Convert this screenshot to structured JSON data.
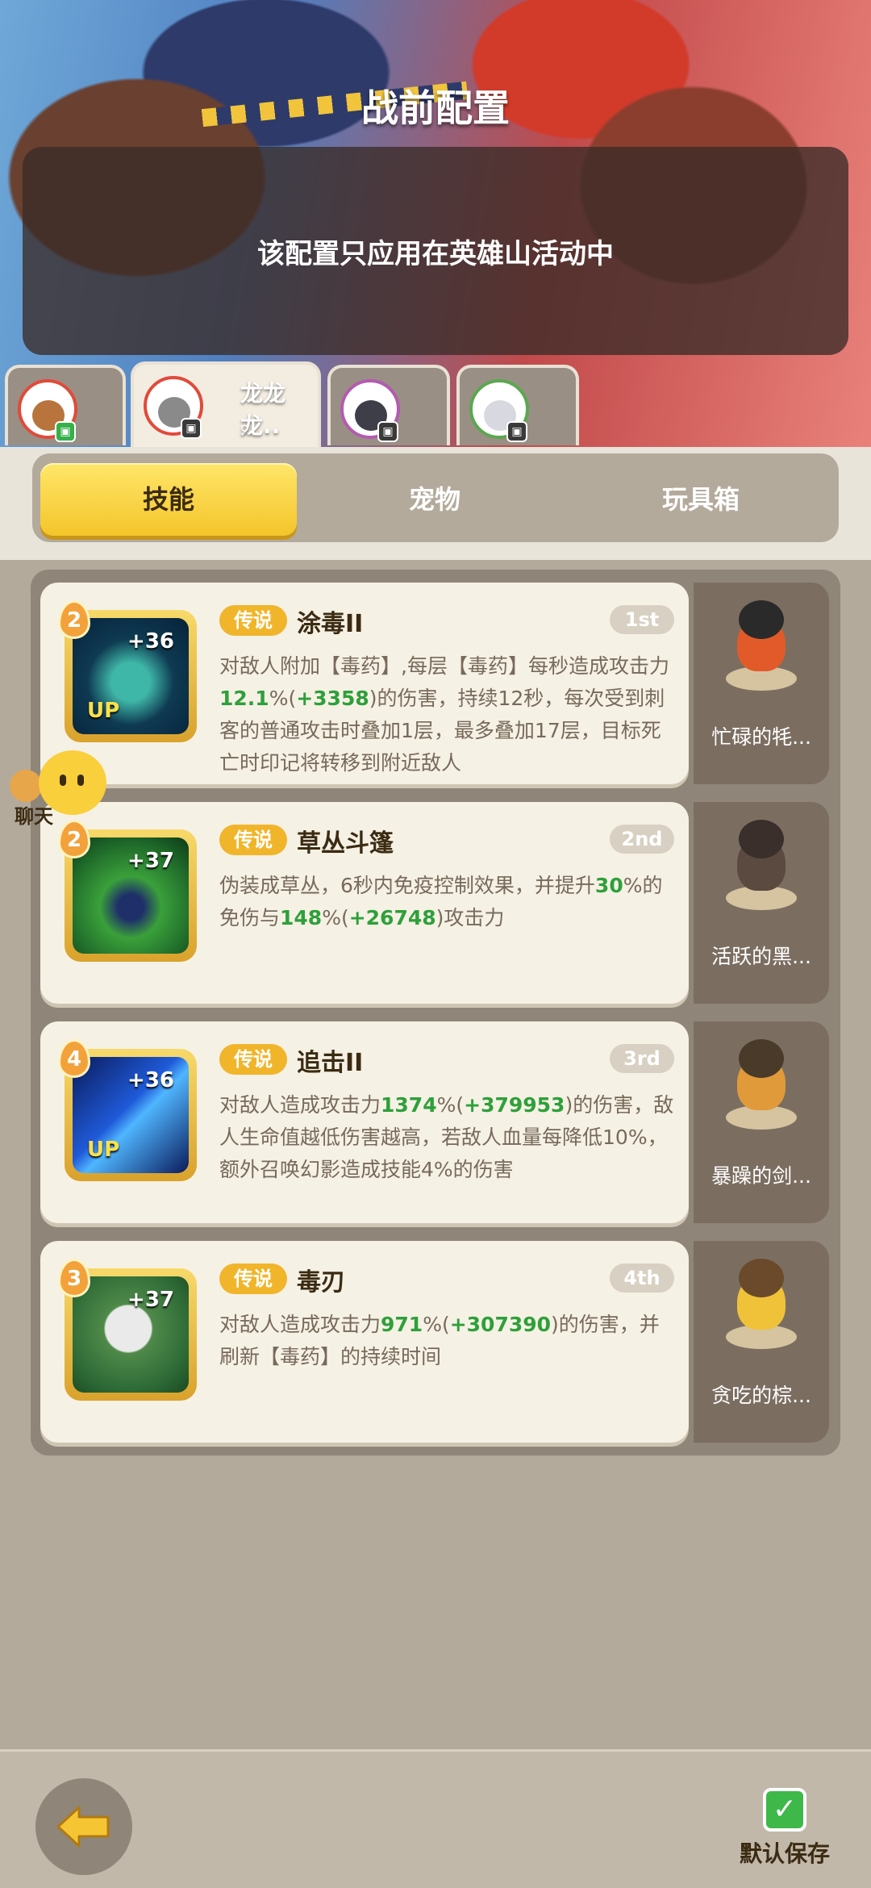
{
  "header": {
    "title": "战前配置",
    "notice": "该配置只应用在英雄山活动中"
  },
  "hero_tabs": [
    {
      "name": "",
      "sub": "",
      "active": false
    },
    {
      "name": "龙龙龙..",
      "sub": "。",
      "active": true
    },
    {
      "name": "",
      "sub": "",
      "active": false
    },
    {
      "name": "",
      "sub": "",
      "active": false
    }
  ],
  "tabs": {
    "skill": "技能",
    "pet": "宠物",
    "toy": "玩具箱"
  },
  "skills": [
    {
      "level": "2",
      "bonus": "+36",
      "up": "UP",
      "tag": "传说",
      "name": "涂毒II",
      "rank": "1st",
      "desc": [
        {
          "t": "对敌人附加【毒药】,每层【毒药】每秒造成攻击力"
        },
        {
          "t": "12.1",
          "g": true
        },
        {
          "t": "%("
        },
        {
          "t": "+3358",
          "g": true
        },
        {
          "t": ")的伤害，持续12秒，每次受到刺客的普通攻击时叠加1层，最多叠加17层，目标死亡时印记将转移到附近敌人"
        }
      ],
      "pet": "忙碌的牦..."
    },
    {
      "level": "2",
      "bonus": "+37",
      "up": "",
      "tag": "传说",
      "name": "草丛斗篷",
      "rank": "2nd",
      "desc": [
        {
          "t": "伪装成草丛，6秒内免疫控制效果，并提升"
        },
        {
          "t": "30",
          "g": true
        },
        {
          "t": "%的免伤与"
        },
        {
          "t": "148",
          "g": true
        },
        {
          "t": "%("
        },
        {
          "t": "+26748",
          "g": true
        },
        {
          "t": ")攻击力"
        }
      ],
      "pet": "活跃的黑..."
    },
    {
      "level": "4",
      "bonus": "+36",
      "up": "UP",
      "tag": "传说",
      "name": "追击II",
      "rank": "3rd",
      "desc": [
        {
          "t": "对敌人造成攻击力"
        },
        {
          "t": "1374",
          "g": true
        },
        {
          "t": "%("
        },
        {
          "t": "+379953",
          "g": true
        },
        {
          "t": ")的伤害，敌人生命值越低伤害越高，若敌人血量每降低10%，额外召唤幻影造成技能4%的伤害"
        }
      ],
      "pet": "暴躁的剑..."
    },
    {
      "level": "3",
      "bonus": "+37",
      "up": "",
      "tag": "传说",
      "name": "毒刃",
      "rank": "4th",
      "desc": [
        {
          "t": "对敌人造成攻击力"
        },
        {
          "t": "971",
          "g": true
        },
        {
          "t": "%("
        },
        {
          "t": "+307390",
          "g": true
        },
        {
          "t": ")的伤害，并刷新【毒药】的持续时间"
        }
      ],
      "pet": "贪吃的棕..."
    }
  ],
  "chat": {
    "label": "聊天"
  },
  "footer": {
    "save_label": "默认保存",
    "check": "✓"
  },
  "colors": {
    "highlight_green": "#2ea03a",
    "tab_yellow": "#f4c52a",
    "legend_tag": "#f1b52b"
  }
}
